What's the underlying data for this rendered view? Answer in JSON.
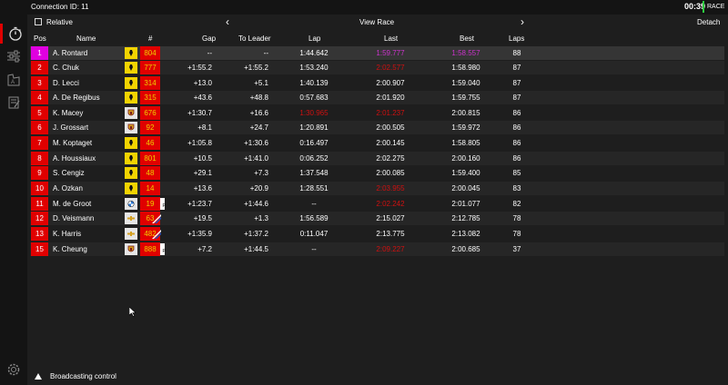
{
  "topbar": {
    "connection": "Connection ID: 11",
    "clock": "00:39",
    "session": "RACE"
  },
  "subbar": {
    "relative_label": "Relative",
    "view_label": "View Race",
    "detach_label": "Detach",
    "prev": "‹",
    "next": "›"
  },
  "headers": {
    "pos": "Pos",
    "name": "Name",
    "num": "#",
    "gap": "Gap",
    "leader": "To Leader",
    "lap": "Lap",
    "last": "Last",
    "best": "Best",
    "laps": "Laps"
  },
  "colors": {
    "accent": "#e00000",
    "leader": "#e000e0",
    "purple": "#cc33cc",
    "red_time": "#d01010",
    "number_text": "#f0d000"
  },
  "rows": [
    {
      "pos": "1",
      "name": "A. Rontard",
      "num": "804",
      "gap": "--",
      "leader": "--",
      "lap": "1:44.642",
      "last": "1:59.777",
      "best": "1:58.557",
      "laps": "88",
      "brand": "ferrari",
      "last_color": "#cc33cc",
      "best_color": "#cc33cc",
      "lap_color": "#ffffff",
      "pflag": ""
    },
    {
      "pos": "2",
      "name": "C. Chuk",
      "num": "777",
      "gap": "+1:55.2",
      "leader": "+1:55.2",
      "lap": "1:53.240",
      "last": "2:02.577",
      "best": "1:58.980",
      "laps": "87",
      "brand": "ferrari",
      "last_color": "#d01010",
      "best_color": "#ffffff",
      "lap_color": "#ffffff",
      "pflag": ""
    },
    {
      "pos": "3",
      "name": "D. Lecci",
      "num": "314",
      "gap": "+13.0",
      "leader": "+5.1",
      "lap": "1:40.139",
      "last": "2:00.907",
      "best": "1:59.040",
      "laps": "87",
      "brand": "ferrari",
      "last_color": "#ffffff",
      "best_color": "#ffffff",
      "lap_color": "#ffffff",
      "pflag": ""
    },
    {
      "pos": "4",
      "name": "A. De Regibus",
      "num": "315",
      "gap": "+43.6",
      "leader": "+48.8",
      "lap": "0:57.683",
      "last": "2:01.920",
      "best": "1:59.755",
      "laps": "87",
      "brand": "ferrari",
      "last_color": "#ffffff",
      "best_color": "#ffffff",
      "lap_color": "#ffffff",
      "pflag": ""
    },
    {
      "pos": "5",
      "name": "K. Macey",
      "num": "676",
      "gap": "+1:30.7",
      "leader": "+16.6",
      "lap": "1:30.965",
      "last": "2:01.237",
      "best": "2:00.815",
      "laps": "86",
      "brand": "porsche",
      "last_color": "#d01010",
      "best_color": "#ffffff",
      "lap_color": "#d01010",
      "pflag": ""
    },
    {
      "pos": "6",
      "name": "J. Grossart",
      "num": "92",
      "gap": "+8.1",
      "leader": "+24.7",
      "lap": "1:20.891",
      "last": "2:00.505",
      "best": "1:59.972",
      "laps": "86",
      "brand": "porsche",
      "last_color": "#ffffff",
      "best_color": "#ffffff",
      "lap_color": "#ffffff",
      "pflag": ""
    },
    {
      "pos": "7",
      "name": "M. Koptaget",
      "num": "46",
      "gap": "+1:05.8",
      "leader": "+1:30.6",
      "lap": "0:16.497",
      "last": "2:00.145",
      "best": "1:58.805",
      "laps": "86",
      "brand": "ferrari",
      "last_color": "#ffffff",
      "best_color": "#ffffff",
      "lap_color": "#ffffff",
      "pflag": ""
    },
    {
      "pos": "8",
      "name": "A. Houssiaux",
      "num": "801",
      "gap": "+10.5",
      "leader": "+1:41.0",
      "lap": "0:06.252",
      "last": "2:02.275",
      "best": "2:00.160",
      "laps": "86",
      "brand": "ferrari",
      "last_color": "#ffffff",
      "best_color": "#ffffff",
      "lap_color": "#ffffff",
      "pflag": ""
    },
    {
      "pos": "9",
      "name": "S. Cengiz",
      "num": "48",
      "gap": "+29.1",
      "leader": "+7.3",
      "lap": "1:37.548",
      "last": "2:00.085",
      "best": "1:59.400",
      "laps": "85",
      "brand": "ferrari",
      "last_color": "#ffffff",
      "best_color": "#ffffff",
      "lap_color": "#ffffff",
      "pflag": ""
    },
    {
      "pos": "10",
      "name": "A. Ozkan",
      "num": "14",
      "gap": "+13.6",
      "leader": "+20.9",
      "lap": "1:28.551",
      "last": "2:03.955",
      "best": "2:00.045",
      "laps": "83",
      "brand": "ferrari",
      "last_color": "#d01010",
      "best_color": "#ffffff",
      "lap_color": "#ffffff",
      "pflag": ""
    },
    {
      "pos": "11",
      "name": "M. de Groot",
      "num": "19",
      "gap": "+1:23.7",
      "leader": "+1:44.6",
      "lap": "--",
      "last": "2:02.242",
      "best": "2:01.077",
      "laps": "82",
      "brand": "bmw",
      "last_color": "#d01010",
      "best_color": "#ffffff",
      "lap_color": "#ffffff",
      "pflag": "P"
    },
    {
      "pos": "12",
      "name": "D. Veismann",
      "num": "63",
      "gap": "+19.5",
      "leader": "+1.3",
      "lap": "1:56.589",
      "last": "2:15.027",
      "best": "2:12.785",
      "laps": "78",
      "brand": "chevrolet",
      "last_color": "#ffffff",
      "best_color": "#ffffff",
      "lap_color": "#ffffff",
      "pflag": ""
    },
    {
      "pos": "13",
      "name": "K. Harris",
      "num": "482",
      "gap": "+1:35.9",
      "leader": "+1:37.2",
      "lap": "0:11.047",
      "last": "2:13.775",
      "best": "2:13.082",
      "laps": "78",
      "brand": "chevrolet",
      "last_color": "#ffffff",
      "best_color": "#ffffff",
      "lap_color": "#ffffff",
      "pflag": ""
    },
    {
      "pos": "15",
      "name": "K. Cheung",
      "num": "888",
      "gap": "+7.2",
      "leader": "+1:44.5",
      "lap": "--",
      "last": "2:09.227",
      "best": "2:00.685",
      "laps": "37",
      "brand": "porsche",
      "last_color": "#d01010",
      "best_color": "#ffffff",
      "lap_color": "#ffffff",
      "pflag": "P"
    }
  ],
  "footer": {
    "label": "Broadcasting control"
  }
}
